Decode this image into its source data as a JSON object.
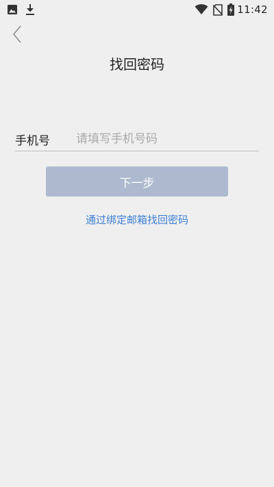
{
  "status_bar": {
    "time": "11:42",
    "left_icons": [
      "image-icon",
      "download-icon"
    ],
    "right_icons": [
      "wifi-icon",
      "no-sim-icon",
      "battery-charging-icon"
    ]
  },
  "nav": {
    "back_icon": "chevron-left-icon"
  },
  "page": {
    "title": "找回密码"
  },
  "form": {
    "phone_label": "手机号",
    "phone_placeholder": "请填写手机号码",
    "phone_value": ""
  },
  "actions": {
    "next_label": "下一步",
    "email_link_label": "通过绑定邮箱找回密码"
  },
  "colors": {
    "background": "#efefef",
    "button_disabled": "#adb9cf",
    "link": "#3d7fd6"
  }
}
